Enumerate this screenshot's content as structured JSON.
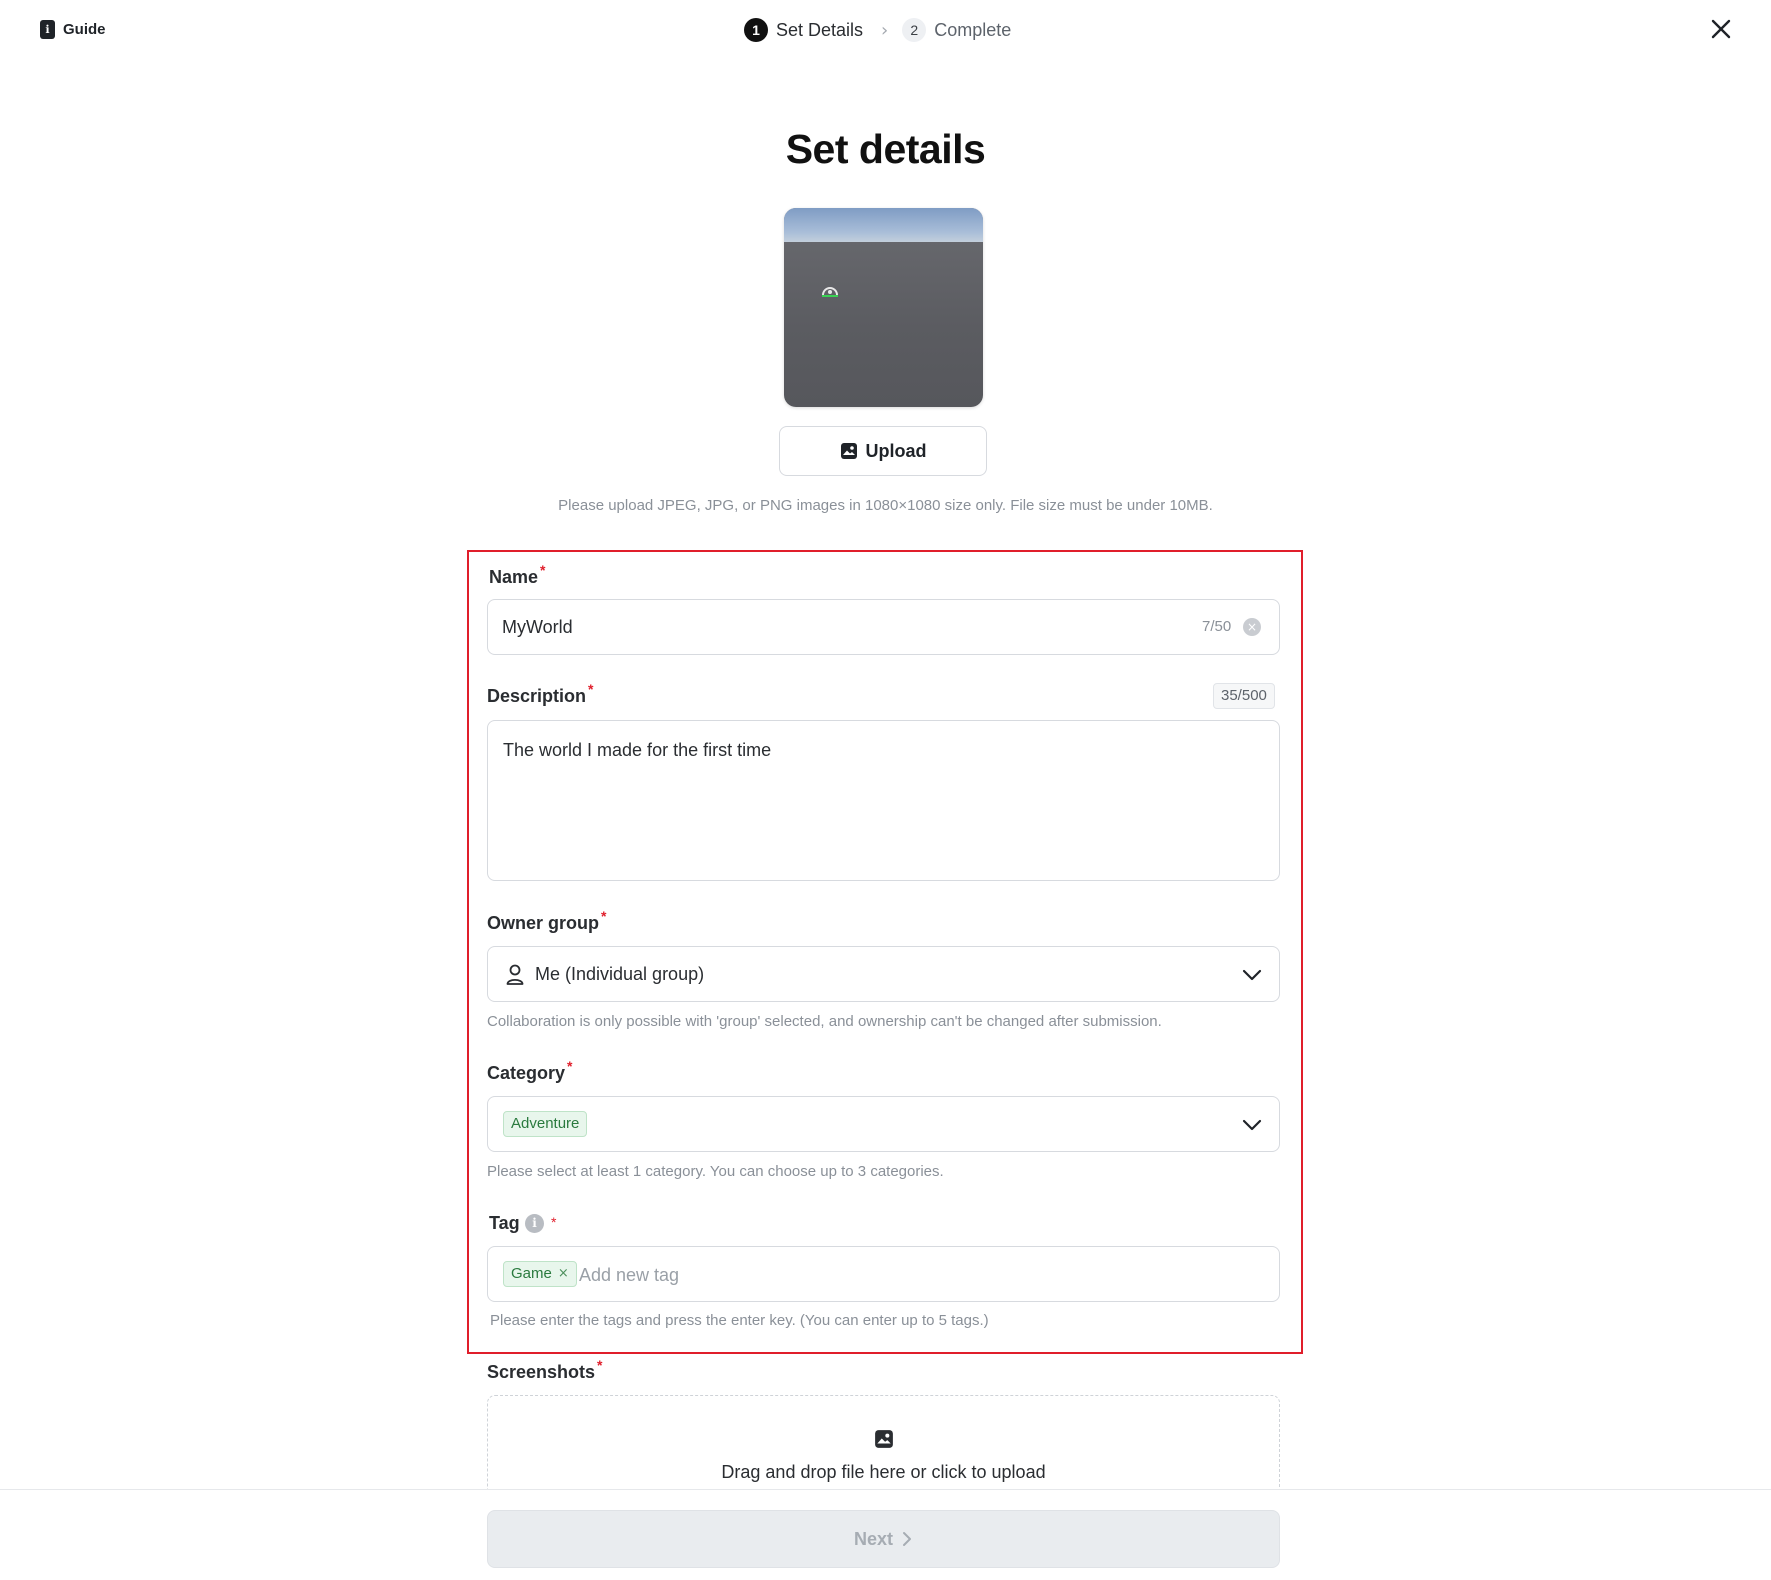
{
  "header": {
    "guide_label": "Guide",
    "steps": [
      {
        "number": "1",
        "label": "Set Details",
        "state": "active"
      },
      {
        "number": "2",
        "label": "Complete",
        "state": "inactive"
      }
    ]
  },
  "page": {
    "title": "Set details",
    "upload_label": "Upload",
    "upload_hint": "Please upload JPEG, JPG, or PNG images in 1080×1080 size only. File size must be under 10MB."
  },
  "form": {
    "name": {
      "label": "Name",
      "value": "MyWorld",
      "counter": "7/50"
    },
    "description": {
      "label": "Description",
      "value": "The world I made for the first time",
      "counter": "35/500"
    },
    "owner_group": {
      "label": "Owner group",
      "selected": "Me (Individual group)",
      "hint": "Collaboration is only possible with 'group' selected, and ownership can't be changed after submission."
    },
    "category": {
      "label": "Category",
      "selected_chip": "Adventure",
      "hint": "Please select at least 1 category. You can choose up to 3 categories."
    },
    "tag": {
      "label": "Tag",
      "chip": "Game",
      "placeholder": "Add new tag",
      "hint": "Please enter the tags and press the enter key. (You can enter up to 5 tags.)"
    },
    "screenshots": {
      "label": "Screenshots",
      "dropzone_text": "Drag and drop file here or click to upload"
    },
    "required_mark": "*"
  },
  "footer": {
    "next_label": "Next"
  },
  "colors": {
    "required": "#e01e2b",
    "highlight_border": "#e01e2b",
    "chip_bg": "#e8f6ec",
    "chip_text": "#2a7a3e"
  }
}
